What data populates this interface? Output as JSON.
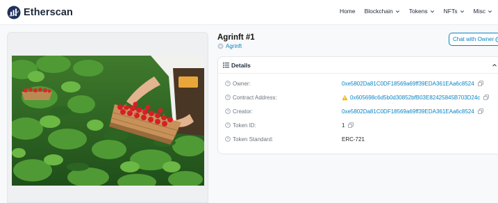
{
  "header": {
    "brand": "Etherscan",
    "nav": [
      {
        "label": "Home",
        "dropdown": false
      },
      {
        "label": "Blockchain",
        "dropdown": true
      },
      {
        "label": "Tokens",
        "dropdown": true
      },
      {
        "label": "NFTs",
        "dropdown": true
      },
      {
        "label": "Misc",
        "dropdown": true
      }
    ]
  },
  "token": {
    "title": "Agrinft #1",
    "collection": "Agrinft",
    "chat_label": "Chat with Owner"
  },
  "details": {
    "heading": "Details",
    "rows": [
      {
        "label": "Owner:",
        "value": "0xe5802Da81C0DF18569a69ff39EDA361EAa6c8524"
      },
      {
        "label": "Contract Address:",
        "value": "0x605698c6d5b0d30852bfB03E82425845B703D24c"
      },
      {
        "label": "Creator:",
        "value": "0xe5802Da81C0DF18569a69ff39EDA361EAa6c8524"
      },
      {
        "label": "Token ID:",
        "value": "1"
      },
      {
        "label": "Token Standard:",
        "value": "ERC-721"
      }
    ]
  },
  "colors": {
    "link": "#0784c3",
    "warning": "#f0b90b",
    "label": "#6c757d"
  },
  "image": {
    "subject": "hands holding a wicker basket of strawberries in a strawberry field"
  }
}
